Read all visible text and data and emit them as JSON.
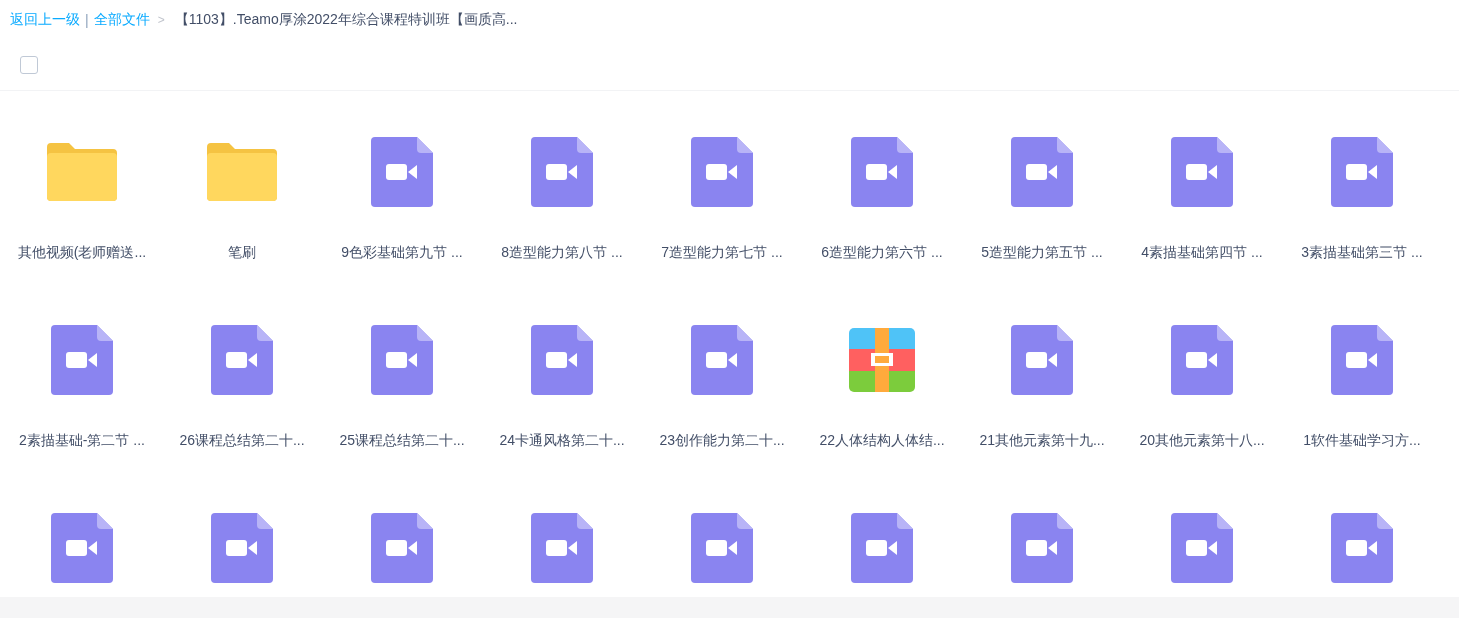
{
  "breadcrumb": {
    "back": "返回上一级",
    "separator": "|",
    "root": "全部文件",
    "arrow": ">",
    "current": "【1103】.Teamo厚涂2022年综合课程特训班【画质高..."
  },
  "select_all": {
    "checked": false
  },
  "files": [
    {
      "kind": "folder",
      "name": "其他视频(老师赠送..."
    },
    {
      "kind": "folder",
      "name": "笔刷"
    },
    {
      "kind": "video",
      "name": "9色彩基础第九节 ..."
    },
    {
      "kind": "video",
      "name": "8造型能力第八节 ..."
    },
    {
      "kind": "video",
      "name": "7造型能力第七节 ..."
    },
    {
      "kind": "video",
      "name": "6造型能力第六节 ..."
    },
    {
      "kind": "video",
      "name": "5造型能力第五节 ..."
    },
    {
      "kind": "video",
      "name": "4素描基础第四节 ..."
    },
    {
      "kind": "video",
      "name": "3素描基础第三节 ..."
    },
    {
      "kind": "video",
      "name": "2素描基础-第二节 ..."
    },
    {
      "kind": "video",
      "name": "26课程总结第二十..."
    },
    {
      "kind": "video",
      "name": "25课程总结第二十..."
    },
    {
      "kind": "video",
      "name": "24卡通风格第二十..."
    },
    {
      "kind": "video",
      "name": "23创作能力第二十..."
    },
    {
      "kind": "archive",
      "name": "22人体结构人体结..."
    },
    {
      "kind": "video",
      "name": "21其他元素第十九..."
    },
    {
      "kind": "video",
      "name": "20其他元素第十八..."
    },
    {
      "kind": "video",
      "name": "1软件基础学习方..."
    },
    {
      "kind": "video"
    },
    {
      "kind": "video"
    },
    {
      "kind": "video"
    },
    {
      "kind": "video"
    },
    {
      "kind": "video"
    },
    {
      "kind": "video"
    },
    {
      "kind": "video"
    },
    {
      "kind": "video"
    },
    {
      "kind": "video"
    }
  ]
}
